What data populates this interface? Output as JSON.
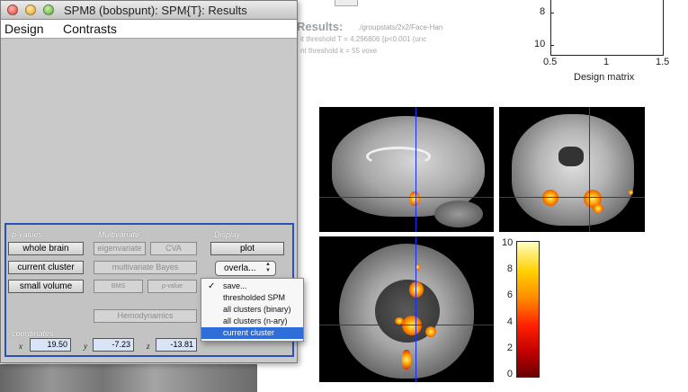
{
  "window": {
    "title": "SPM8 (bobspunt): SPM{T}: Results"
  },
  "menubar": {
    "items": [
      "Design",
      "Contrasts"
    ]
  },
  "results_panel": {
    "heading": "Results:",
    "path": "./groupstats/2x2/Face-Han",
    "line1": "it threshold T = 4.296806 {p<0.001 (unc",
    "line2": "nt threshold k = 55 voxe"
  },
  "design_matrix": {
    "label": "Design matrix",
    "yticks": [
      "8",
      "10"
    ],
    "xticks": [
      "0.5",
      "1",
      "1.5"
    ]
  },
  "colorbar": {
    "ticks": [
      "10",
      "8",
      "6",
      "4",
      "2",
      "0"
    ]
  },
  "controls": {
    "pvalues_label": "p-values",
    "multivariate_label": "Multivariate",
    "display_label": "Display",
    "coordinates_label": "coordinates",
    "whole_brain": "whole brain",
    "current_cluster": "current cluster",
    "small_volume": "small volume",
    "eigenvariate": "eigenvariate",
    "cva": "CVA",
    "multivariate_bayes": "multivariate Bayes",
    "bms": "BMS",
    "pvalue": "p-value",
    "hemodynamics": "Hemodynamics",
    "plot": "plot",
    "overlay_popup": "overla..."
  },
  "coordinates": {
    "x_label": "x",
    "y_label": "y",
    "z_label": "z",
    "x": "19.50",
    "y": "-7.23",
    "z": "-13.81"
  },
  "dropdown": {
    "items": [
      "save...",
      "thresholded SPM",
      "all clusters (binary)",
      "all clusters (n-ary)",
      "current cluster"
    ],
    "checked_item": "save...",
    "selected_item": "current cluster"
  },
  "colors": {
    "selection": "#2f6dd8",
    "crosshair": "#1a2cff",
    "panel_border": "#2850b8"
  }
}
